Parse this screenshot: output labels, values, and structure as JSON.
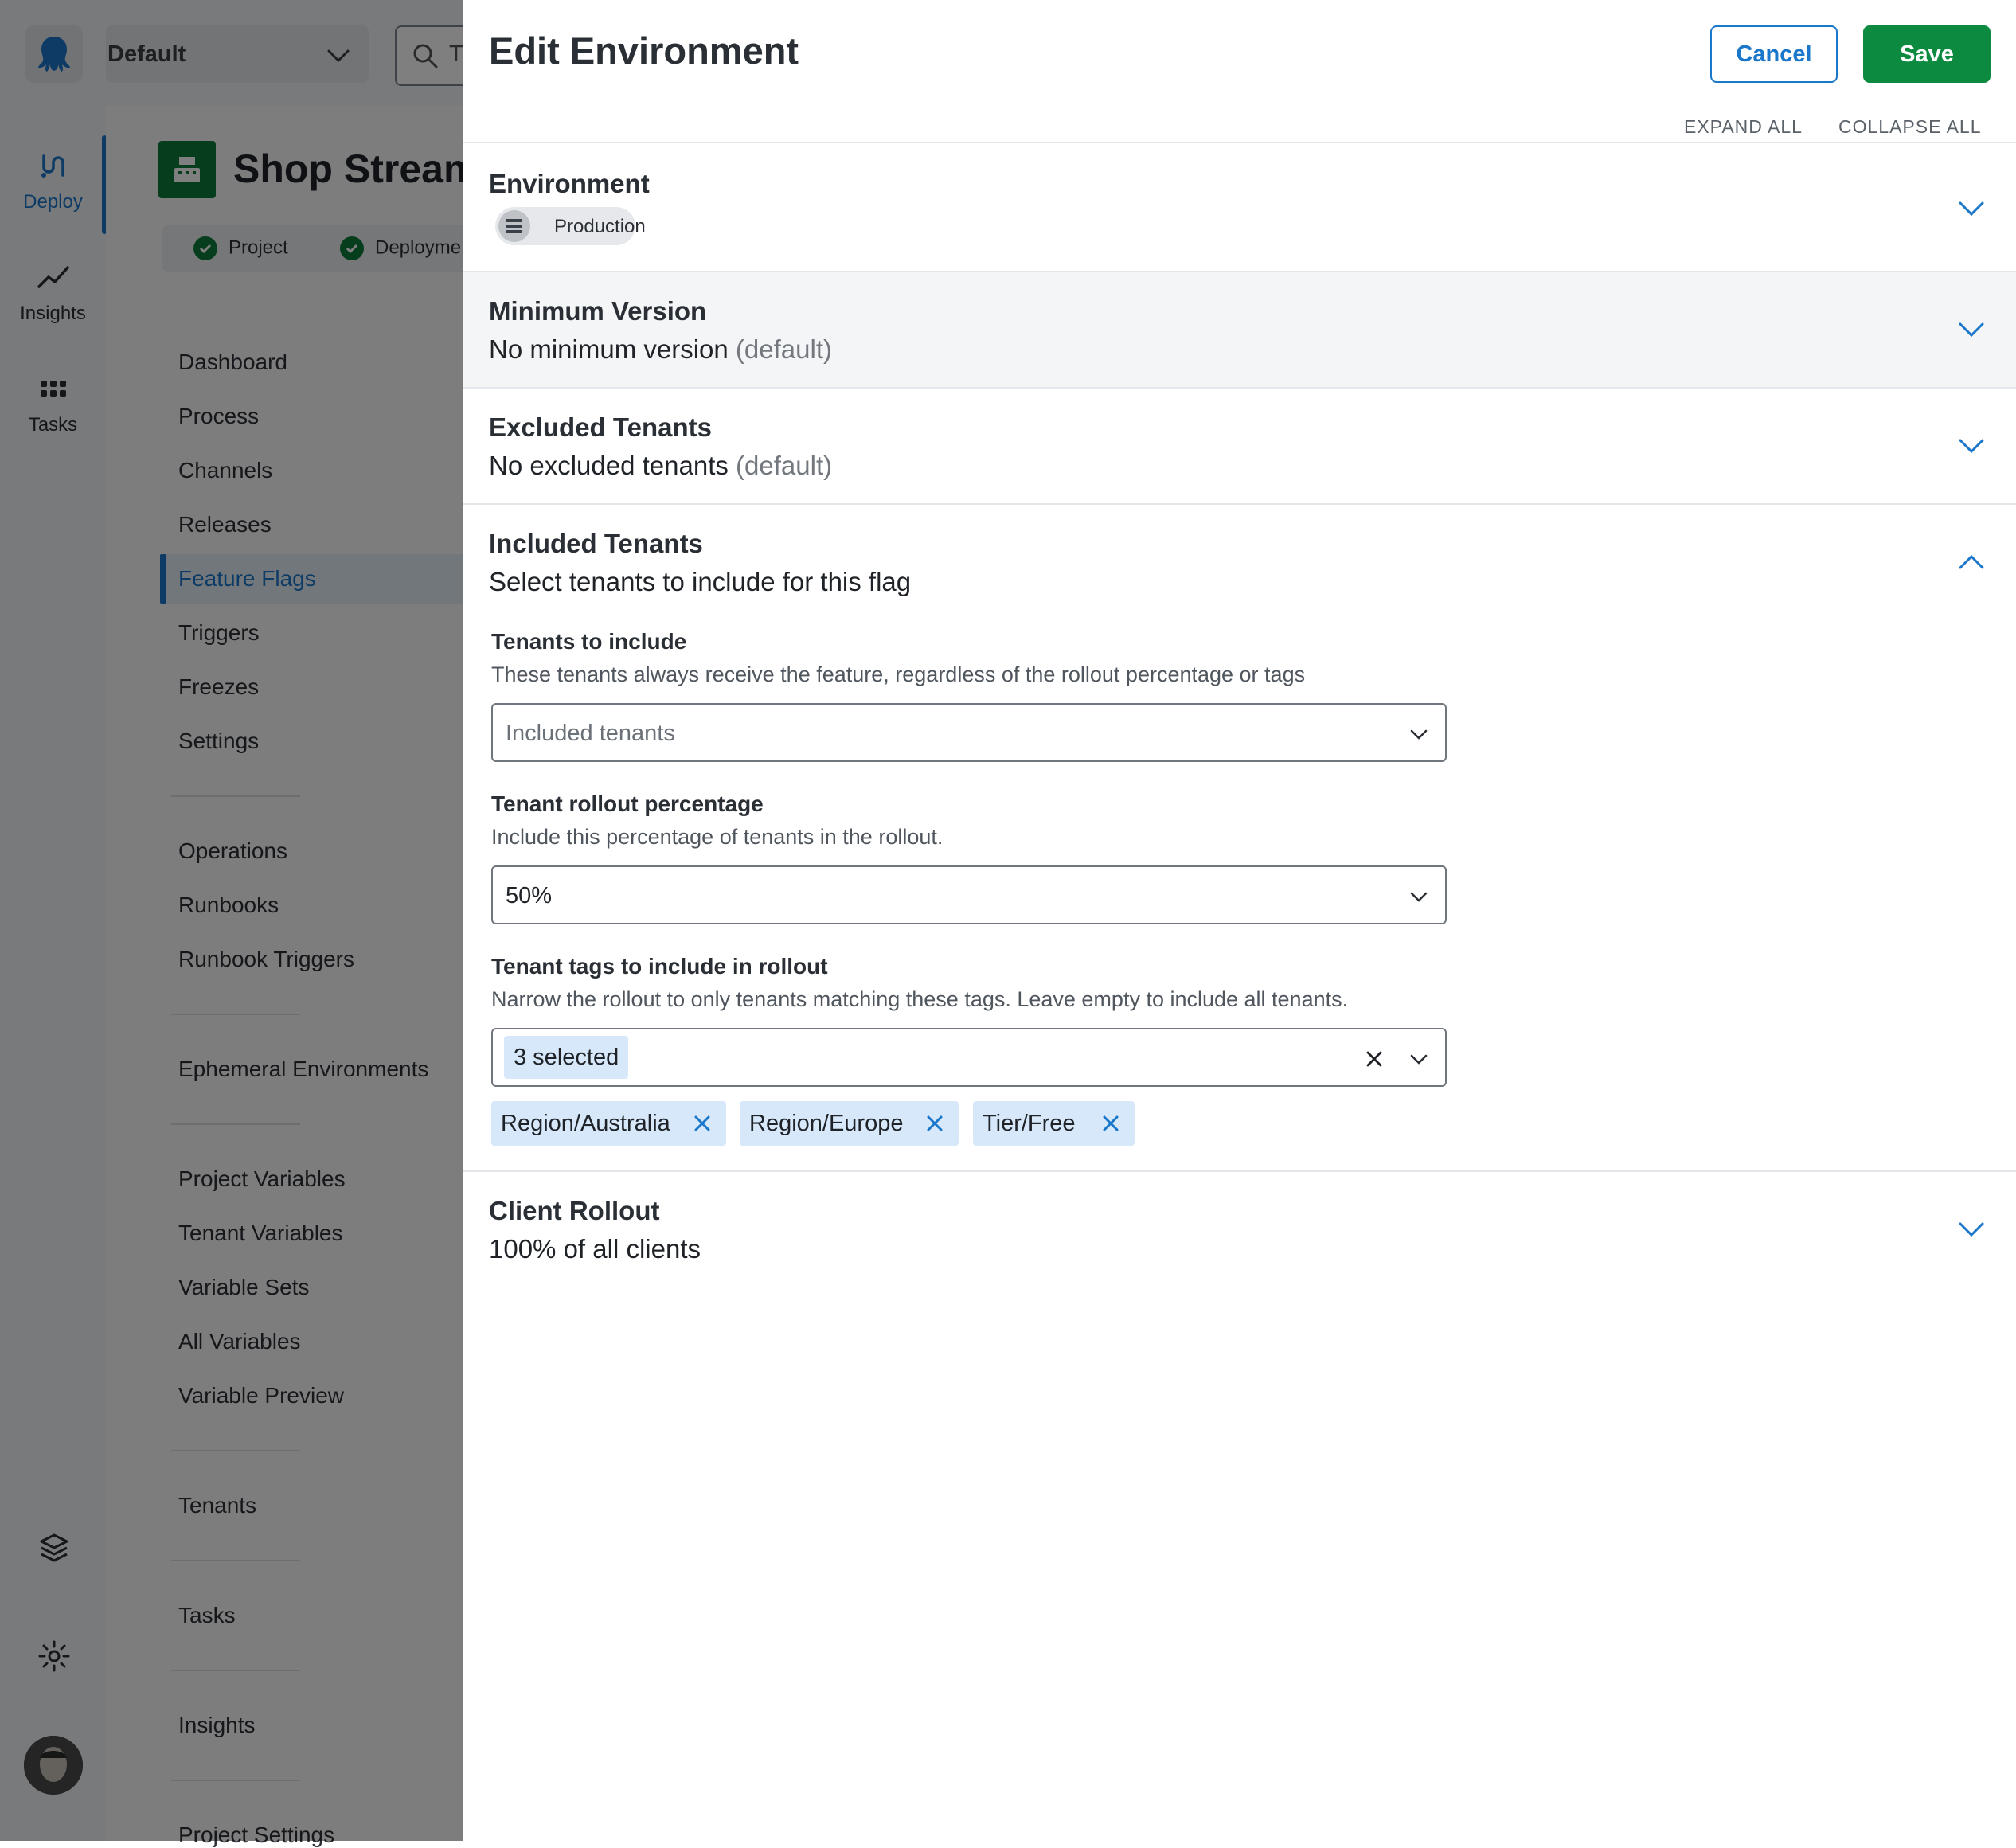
{
  "app": {
    "space_name": "Default",
    "search_placeholder": "T",
    "rail": [
      {
        "label": "Deploy",
        "icon": "deploy-icon",
        "active": true
      },
      {
        "label": "Insights",
        "icon": "insights-icon",
        "active": false
      },
      {
        "label": "Tasks",
        "icon": "tasks-icon",
        "active": false
      }
    ],
    "project": {
      "title": "Shop Stream",
      "status": [
        {
          "label": "Project"
        },
        {
          "label": "Deployme"
        }
      ]
    },
    "nav": [
      "Dashboard",
      "Process",
      "Channels",
      "Releases",
      "Feature Flags",
      "Triggers",
      "Freezes",
      "Settings",
      "Operations",
      "Runbooks",
      "Runbook Triggers",
      "Ephemeral Environments",
      "Project Variables",
      "Tenant Variables",
      "Variable Sets",
      "All Variables",
      "Variable Preview",
      "Tenants",
      "Tasks",
      "Insights",
      "Project Settings"
    ],
    "nav_active": "Feature Flags",
    "colors": {
      "accent": "#1a77ca",
      "brand_green": "#0c8a3f",
      "tag_bg": "#d6e8fa"
    }
  },
  "drawer": {
    "title": "Edit Environment",
    "cancel_label": "Cancel",
    "save_label": "Save",
    "expand_all": "EXPAND ALL",
    "collapse_all": "COLLAPSE ALL",
    "sections": {
      "environment": {
        "title": "Environment",
        "chip": "Production",
        "expanded": false
      },
      "minimum_version": {
        "title": "Minimum Version",
        "summary": "No minimum version",
        "summary_muted": "(default)",
        "expanded": false
      },
      "excluded_tenants": {
        "title": "Excluded Tenants",
        "summary": "No excluded tenants",
        "summary_muted": "(default)",
        "expanded": false
      },
      "included_tenants": {
        "title": "Included Tenants",
        "summary": "Select tenants to include for this flag",
        "expanded": true,
        "tenants_to_include": {
          "label": "Tenants to include",
          "help": "These tenants always receive the feature, regardless of the rollout percentage or tags",
          "placeholder": "Included tenants"
        },
        "rollout_percentage": {
          "label": "Tenant rollout percentage",
          "help": "Include this percentage of tenants in the rollout.",
          "value": "50%"
        },
        "tenant_tags": {
          "label": "Tenant tags to include in rollout",
          "help": "Narrow the rollout to only tenants matching these tags. Leave empty to include all tenants.",
          "selected_count": "3 selected",
          "tags": [
            "Region/Australia",
            "Region/Europe",
            "Tier/Free"
          ]
        }
      },
      "client_rollout": {
        "title": "Client Rollout",
        "summary": "100% of all clients",
        "expanded": false
      }
    }
  }
}
